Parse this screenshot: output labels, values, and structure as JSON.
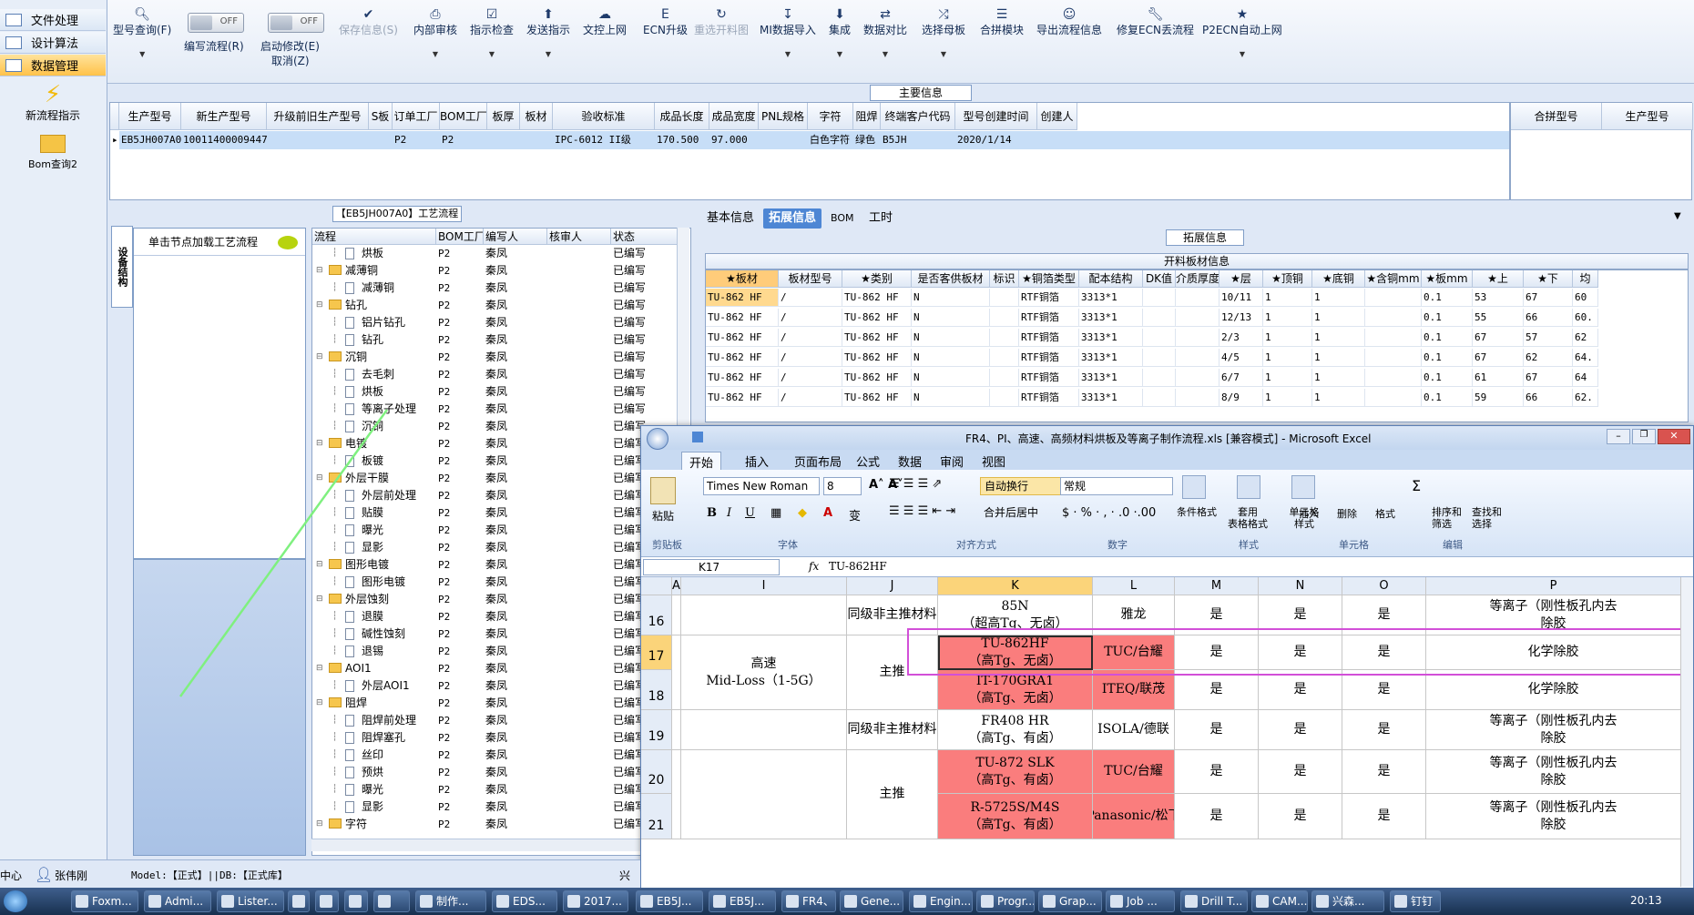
{
  "leftnav": {
    "tabs": [
      "文件处理",
      "设计算法",
      "数据管理"
    ],
    "items": [
      "新流程指示",
      "Bom查询2"
    ]
  },
  "toolbar": {
    "buttons": [
      {
        "label": "型号查询(F)",
        "icon": "search-icon"
      },
      {
        "label": "编写流程(R)",
        "toggle": "OFF"
      },
      {
        "label": "启动修改(E)",
        "sub": "取消(Z)",
        "toggle": "OFF"
      },
      {
        "label": "保存信息(S)",
        "icon": "check-icon",
        "disabled": true
      },
      {
        "label": "内部审核",
        "icon": "print-icon"
      },
      {
        "label": "指示检查",
        "icon": "check-icon"
      },
      {
        "label": "发送指示",
        "icon": "upload-icon"
      },
      {
        "label": "文控上网",
        "icon": "cloud-icon"
      },
      {
        "label": "ECN升级",
        "icon": "ecn-icon"
      },
      {
        "label": "重选开料图",
        "icon": "redo-icon",
        "disabled": true
      },
      {
        "label": "MI数据导入",
        "icon": "import-icon"
      },
      {
        "label": "集成",
        "icon": "download-icon"
      },
      {
        "label": "数据对比",
        "icon": "compare-icon"
      },
      {
        "label": "选择母板",
        "icon": "shuffle-icon"
      },
      {
        "label": "合拼模块",
        "icon": "list-icon"
      },
      {
        "label": "导出流程信息",
        "icon": "smile-icon"
      },
      {
        "label": "修复ECN丢流程",
        "icon": "wrench-icon"
      },
      {
        "label": "P2ECN自动上网",
        "icon": "star-icon"
      }
    ]
  },
  "main_info": {
    "title": "主要信息",
    "columns": [
      "生产型号",
      "新生产型号",
      "升级前旧生产型号",
      "S板",
      "订单工厂",
      "BOM工厂",
      "板厚",
      "板材",
      "验收标准",
      "成品长度",
      "成品宽度",
      "PNL规格",
      "字符",
      "阻焊",
      "终端客户代码",
      "型号创建时间",
      "创建人"
    ],
    "row": [
      "EB5JH007A0",
      "10011400009447",
      "",
      "",
      "P2",
      "P2",
      "",
      "",
      "IPC-6012 II级",
      "170.500",
      "97.000",
      "",
      "白色字符",
      "绿色",
      "B5JH",
      "2020/1/14",
      ""
    ],
    "side_columns": [
      "合拼型号",
      "生产型号"
    ]
  },
  "flow_panel": {
    "title": "【EB5JH007A0】工艺流程",
    "vertical_tab": "设备结构",
    "node_hint": "单击节点加载工艺流程",
    "columns": [
      "流程",
      "BOM工厂",
      "编写人",
      "核审人",
      "状态"
    ],
    "rows": [
      {
        "name": "烘板",
        "level": 2
      },
      {
        "name": "减薄铜",
        "level": 1
      },
      {
        "name": "减薄铜",
        "level": 2
      },
      {
        "name": "钻孔",
        "level": 1
      },
      {
        "name": "铝片钻孔",
        "level": 2
      },
      {
        "name": "钻孔",
        "level": 2
      },
      {
        "name": "沉铜",
        "level": 1
      },
      {
        "name": "去毛刺",
        "level": 2
      },
      {
        "name": "烘板",
        "level": 2
      },
      {
        "name": "等离子处理",
        "level": 2
      },
      {
        "name": "沉铜",
        "level": 2
      },
      {
        "name": "电镀",
        "level": 1
      },
      {
        "name": "板镀",
        "level": 2
      },
      {
        "name": "外层干膜",
        "level": 1
      },
      {
        "name": "外层前处理",
        "level": 2
      },
      {
        "name": "贴膜",
        "level": 2
      },
      {
        "name": "曝光",
        "level": 2
      },
      {
        "name": "显影",
        "level": 2
      },
      {
        "name": "图形电镀",
        "level": 1
      },
      {
        "name": "图形电镀",
        "level": 2
      },
      {
        "name": "外层蚀刻",
        "level": 1
      },
      {
        "name": "退膜",
        "level": 2
      },
      {
        "name": "碱性蚀刻",
        "level": 2
      },
      {
        "name": "退锡",
        "level": 2
      },
      {
        "name": "AOI1",
        "level": 1
      },
      {
        "name": "外层AOI1",
        "level": 2
      },
      {
        "name": "阻焊",
        "level": 1
      },
      {
        "name": "阻焊前处理",
        "level": 2
      },
      {
        "name": "阻焊塞孔",
        "level": 2
      },
      {
        "name": "丝印",
        "level": 2
      },
      {
        "name": "预烘",
        "level": 2
      },
      {
        "name": "曝光",
        "level": 2
      },
      {
        "name": "显影",
        "level": 2
      },
      {
        "name": "字符",
        "level": 1
      }
    ],
    "bom": "P2",
    "writer": "秦凤",
    "status": "已编写"
  },
  "right_panel": {
    "tabs": [
      "基本信息",
      "拓展信息",
      "BOM",
      "工时"
    ],
    "section": "拓展信息",
    "table_title": "开料板材信息",
    "columns": [
      "★板材",
      "板材型号",
      "★类别",
      "是否客供板材",
      "标识",
      "★铜箔类型",
      "配本结构",
      "DK值",
      "介质厚度",
      "★层",
      "★顶铜",
      "★底铜",
      "★含铜mm",
      "★板mm",
      "★上",
      "★下",
      "均"
    ],
    "rows": [
      [
        "TU-862 HF",
        "/",
        "TU-862 HF",
        "N",
        "",
        "RTF铜箔",
        "3313*1",
        "",
        "",
        "10/11",
        "1",
        "1",
        "",
        "0.1",
        "53",
        "67",
        "60"
      ],
      [
        "TU-862 HF",
        "/",
        "TU-862 HF",
        "N",
        "",
        "RTF铜箔",
        "3313*1",
        "",
        "",
        "12/13",
        "1",
        "1",
        "",
        "0.1",
        "55",
        "66",
        "60."
      ],
      [
        "TU-862 HF",
        "/",
        "TU-862 HF",
        "N",
        "",
        "RTF铜箔",
        "3313*1",
        "",
        "",
        "2/3",
        "1",
        "1",
        "",
        "0.1",
        "67",
        "57",
        "62"
      ],
      [
        "TU-862 HF",
        "/",
        "TU-862 HF",
        "N",
        "",
        "RTF铜箔",
        "3313*1",
        "",
        "",
        "4/5",
        "1",
        "1",
        "",
        "0.1",
        "67",
        "62",
        "64."
      ],
      [
        "TU-862 HF",
        "/",
        "TU-862 HF",
        "N",
        "",
        "RTF铜箔",
        "3313*1",
        "",
        "",
        "6/7",
        "1",
        "1",
        "",
        "0.1",
        "61",
        "67",
        "64"
      ],
      [
        "TU-862 HF",
        "/",
        "TU-862 HF",
        "N",
        "",
        "RTF铜箔",
        "3313*1",
        "",
        "",
        "8/9",
        "1",
        "1",
        "",
        "0.1",
        "59",
        "66",
        "62."
      ]
    ]
  },
  "excel": {
    "title": "FR4、PI、高速、高频材料烘板及等离子制作流程.xls [兼容模式] - Microsoft Excel",
    "tabs": [
      "开始",
      "插入",
      "页面布局",
      "公式",
      "数据",
      "审阅",
      "视图"
    ],
    "font_name": "Times New Roman",
    "font_size": "8",
    "number_format": "常规",
    "wrap_text": "自动换行",
    "merge": "合并后居中",
    "groups": [
      "剪贴板",
      "字体",
      "对齐方式",
      "数字",
      "样式",
      "单元格",
      "编辑"
    ],
    "paste": "粘贴",
    "style_btns": [
      "条件格式",
      "套用\n表格格式",
      "单元格\n样式"
    ],
    "cell_btns": [
      "插入",
      "删除",
      "格式"
    ],
    "edit_btns": [
      "排序和\n筛选",
      "查找和\n选择"
    ],
    "name_box": "K17",
    "formula": "TU-862HF",
    "col_headers": [
      "A",
      "I",
      "J",
      "K",
      "L",
      "M",
      "N",
      "O",
      "P"
    ],
    "row_numbers": [
      "16",
      "17",
      "18",
      "19",
      "20",
      "21"
    ],
    "cells": {
      "r16_j": "同级非主推材料",
      "r16_k": "85N\n（超高Tg、无卤）",
      "r16_l": "雅龙",
      "r17_k": "TU-862HF\n（高Tg、无卤）",
      "r17_l": "TUC/台耀",
      "r18_i": "高速\nMid-Loss（1-5G）",
      "r18_j": "主推",
      "r18_k": "IT-170GRA1\n（高Tg、无卤）",
      "r18_l": "ITEQ/联茂",
      "r19_j": "同级非主推材料",
      "r19_k": "FR408 HR\n（高Tg、有卤）",
      "r19_l": "ISOLA/德联",
      "r20_j": "主推",
      "r20_k": "TU-872 SLK\n（高Tg、有卤）",
      "r20_l": "TUC/台耀",
      "r21_k": "R-5725S/M4S\n（高Tg、有卤）",
      "r21_l": "Panasonic/松下",
      "yes": "是",
      "p_plasma": "等离子（刚性板孔内去\n除胶",
      "p_chem": "化学除胶"
    }
  },
  "statusbar": {
    "center": "中心",
    "user": "张伟刚",
    "model": "Model:【正式】||DB:【正式库】",
    "right": "兴"
  },
  "taskbar": {
    "items": [
      "Foxm...",
      "Admi...",
      "Lister...",
      "",
      "",
      "",
      "",
      "制作...",
      "EDS...",
      "2017...",
      "EB5J...",
      "EB5J...",
      "FR4、...",
      "Gene...",
      "Engin...",
      "Progr...",
      "Grap...",
      "Job ...",
      "Drill T...",
      "CAM...",
      "兴森...",
      "钉钉"
    ],
    "time": "20:13"
  }
}
